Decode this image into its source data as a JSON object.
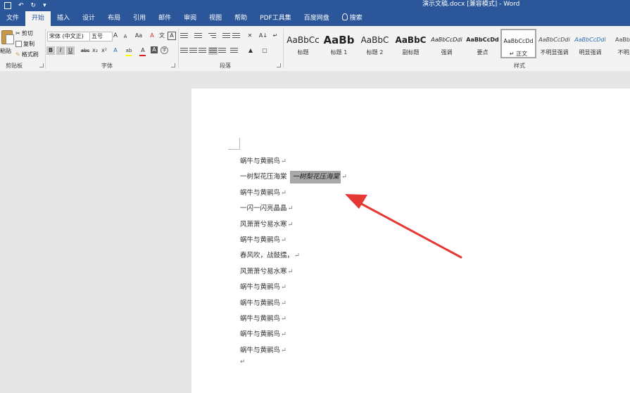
{
  "titlebar": {
    "title": "演示文稿.docx [兼容模式] - Word",
    "qat": [
      "save-icon",
      "undo-icon",
      "redo-icon",
      "customize-icon"
    ]
  },
  "tabs": [
    "文件",
    "开始",
    "插入",
    "设计",
    "布局",
    "引用",
    "邮件",
    "审阅",
    "视图",
    "帮助",
    "PDF工具集",
    "百度网盘",
    "搜索"
  ],
  "active_tab": "开始",
  "ribbon": {
    "clipboard": {
      "paste": "粘贴",
      "cut": "剪切",
      "copy": "复制",
      "format_painter": "格式刷",
      "label": "剪贴板"
    },
    "font": {
      "family": "宋体 (中文正)",
      "size": "五号",
      "grow": "A",
      "shrink": "A",
      "case": "Aa",
      "clear": "A",
      "phonetic": "文",
      "border": "A",
      "bold": "B",
      "italic": "I",
      "underline": "U",
      "strike": "abc",
      "subscript": "x₂",
      "superscript": "x²",
      "effects": "A",
      "highlight": "ab",
      "color": "A",
      "shading": "A",
      "enclose": "字",
      "label": "字体",
      "font_color": "#e02020",
      "highlight_color": "#ffff00"
    },
    "paragraph": {
      "label": "段落",
      "sort": "A↓",
      "marks": "↵"
    },
    "styles": {
      "label": "样式",
      "items": [
        {
          "sample": "AaBbCc",
          "name": "标题"
        },
        {
          "sample": "AaBb",
          "name": "标题 1"
        },
        {
          "sample": "AaBbC",
          "name": "标题 2"
        },
        {
          "sample": "AaBbC",
          "name": "副标题"
        },
        {
          "sample": "AaBbCcDdi",
          "name": "强调"
        },
        {
          "sample": "AaBbCcDd",
          "name": "要点"
        },
        {
          "sample": "AaBbCcDd",
          "name": "正文"
        },
        {
          "sample": "AaBbCcDdi",
          "name": "不明显强调"
        },
        {
          "sample": "AaBbCcDdi",
          "name": "明显强调"
        },
        {
          "sample": "AaBbCc",
          "name": "不明显"
        }
      ],
      "current": "正文"
    }
  },
  "document": {
    "lines": [
      "蜗牛与黄鹂鸟",
      "一树梨花压海棠",
      "蜗牛与黄鹂鸟",
      "一闪一闪亮晶晶",
      "风萧萧兮易水寒",
      "蜗牛与黄鹂鸟",
      "春风吹，战鼓擂，",
      "风萧萧兮易水寒",
      "蜗牛与黄鹂鸟",
      "蜗牛与黄鹂鸟",
      "蜗牛与黄鹂鸟",
      "蜗牛与黄鹂鸟",
      "蜗牛与黄鹂鸟"
    ],
    "highlighted_text": "一树梨花压海棠",
    "paragraph_mark": "↵"
  },
  "annotation": {
    "color": "#e53935"
  }
}
